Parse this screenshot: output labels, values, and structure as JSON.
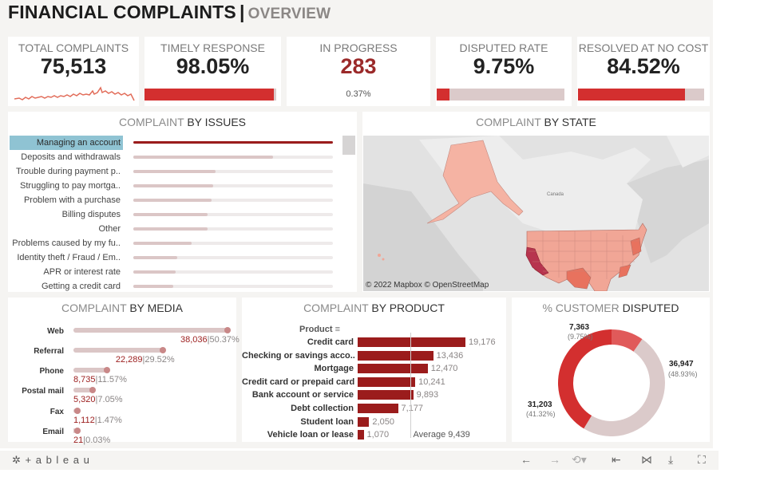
{
  "header": {
    "title": "FINANCIAL COMPLAINTS",
    "separator": "|",
    "subtitle": "OVERVIEW"
  },
  "kpis": {
    "total": {
      "label": "TOTAL COMPLAINTS",
      "value": "75,513"
    },
    "timely": {
      "label": "TIMELY RESPONSE",
      "value": "98.05%",
      "fraction": 0.9805
    },
    "progress": {
      "label": "IN PROGRESS",
      "value": "283",
      "sub": "0.37%"
    },
    "disputed": {
      "label": "DISPUTED RATE",
      "value": "9.75%",
      "fraction": 0.0975
    },
    "resolved": {
      "label": "RESOLVED AT NO COST",
      "value": "84.52%",
      "fraction": 0.8452
    },
    "colors": {
      "accent": "#d32f2f",
      "track": "#dbcaca",
      "in_progress": "#9b2a2a"
    }
  },
  "issues": {
    "title_prefix": "COMPLAINT",
    "title_suffix": "BY ISSUES",
    "rows": [
      {
        "label": "Managing an account",
        "fraction": 1.0,
        "selected": true
      },
      {
        "label": "Deposits and withdrawals",
        "fraction": 0.7
      },
      {
        "label": "Trouble during payment p..",
        "fraction": 0.41
      },
      {
        "label": "Struggling to pay mortga..",
        "fraction": 0.4
      },
      {
        "label": "Problem with a purchase",
        "fraction": 0.39
      },
      {
        "label": "Billing disputes",
        "fraction": 0.37
      },
      {
        "label": "Other",
        "fraction": 0.37
      },
      {
        "label": "Problems caused by my fu..",
        "fraction": 0.29
      },
      {
        "label": "Identity theft / Fraud / Em..",
        "fraction": 0.22
      },
      {
        "label": "APR or interest rate",
        "fraction": 0.21
      },
      {
        "label": "Getting a credit card",
        "fraction": 0.2
      }
    ]
  },
  "state": {
    "title_prefix": "COMPLAINT",
    "title_suffix": "BY STATE",
    "map_label": "Canada",
    "attribution": "© 2022 Mapbox  © OpenStreetMap"
  },
  "media": {
    "title_prefix": "COMPLAINT",
    "title_suffix": "BY MEDIA",
    "rows": [
      {
        "label": "Web",
        "count": "38,036",
        "pct": "50.37%",
        "fraction": 1.0
      },
      {
        "label": "Referral",
        "count": "22,289",
        "pct": "29.52%",
        "fraction": 0.586
      },
      {
        "label": "Phone",
        "count": "8,735",
        "pct": "11.57%",
        "fraction": 0.23
      },
      {
        "label": "Postal mail",
        "count": "5,320",
        "pct": "7.05%",
        "fraction": 0.14
      },
      {
        "label": "Fax",
        "count": "1,112",
        "pct": "1.47%",
        "fraction": 0.03
      },
      {
        "label": "Email",
        "count": "21",
        "pct": "0.03%",
        "fraction": 0.005
      }
    ]
  },
  "product": {
    "title_prefix": "COMPLAINT",
    "title_suffix": "BY PRODUCT",
    "header_label": "Product",
    "average_label": "Average 9,439",
    "rows": [
      {
        "label": "Credit card",
        "value": 19176,
        "display": "19,176"
      },
      {
        "label": "Checking or savings acco..",
        "value": 13436,
        "display": "13,436"
      },
      {
        "label": "Mortgage",
        "value": 12470,
        "display": "12,470"
      },
      {
        "label": "Credit card or prepaid card",
        "value": 10241,
        "display": "10,241"
      },
      {
        "label": "Bank account or service",
        "value": 9893,
        "display": "9,893"
      },
      {
        "label": "Debt collection",
        "value": 7177,
        "display": "7,177"
      },
      {
        "label": "Student loan",
        "value": 2050,
        "display": "2,050"
      },
      {
        "label": "Vehicle loan or lease",
        "value": 1070,
        "display": "1,070"
      }
    ],
    "bar_color": "#9b1c1c"
  },
  "disputed": {
    "title_prefix": "% CUSTOMER",
    "title_suffix": "DISPUTED",
    "segments": [
      {
        "count": "7,363",
        "pct": "(9.75%)",
        "value": 7363,
        "color": "#e05a5a"
      },
      {
        "count": "36,947",
        "pct": "(48.93%)",
        "value": 36947,
        "color": "#dbcaca"
      },
      {
        "count": "31,203",
        "pct": "(41.32%)",
        "value": 31203,
        "color": "#d32f2f"
      }
    ]
  },
  "footer": {
    "brand": "+ a b l e a u"
  }
}
